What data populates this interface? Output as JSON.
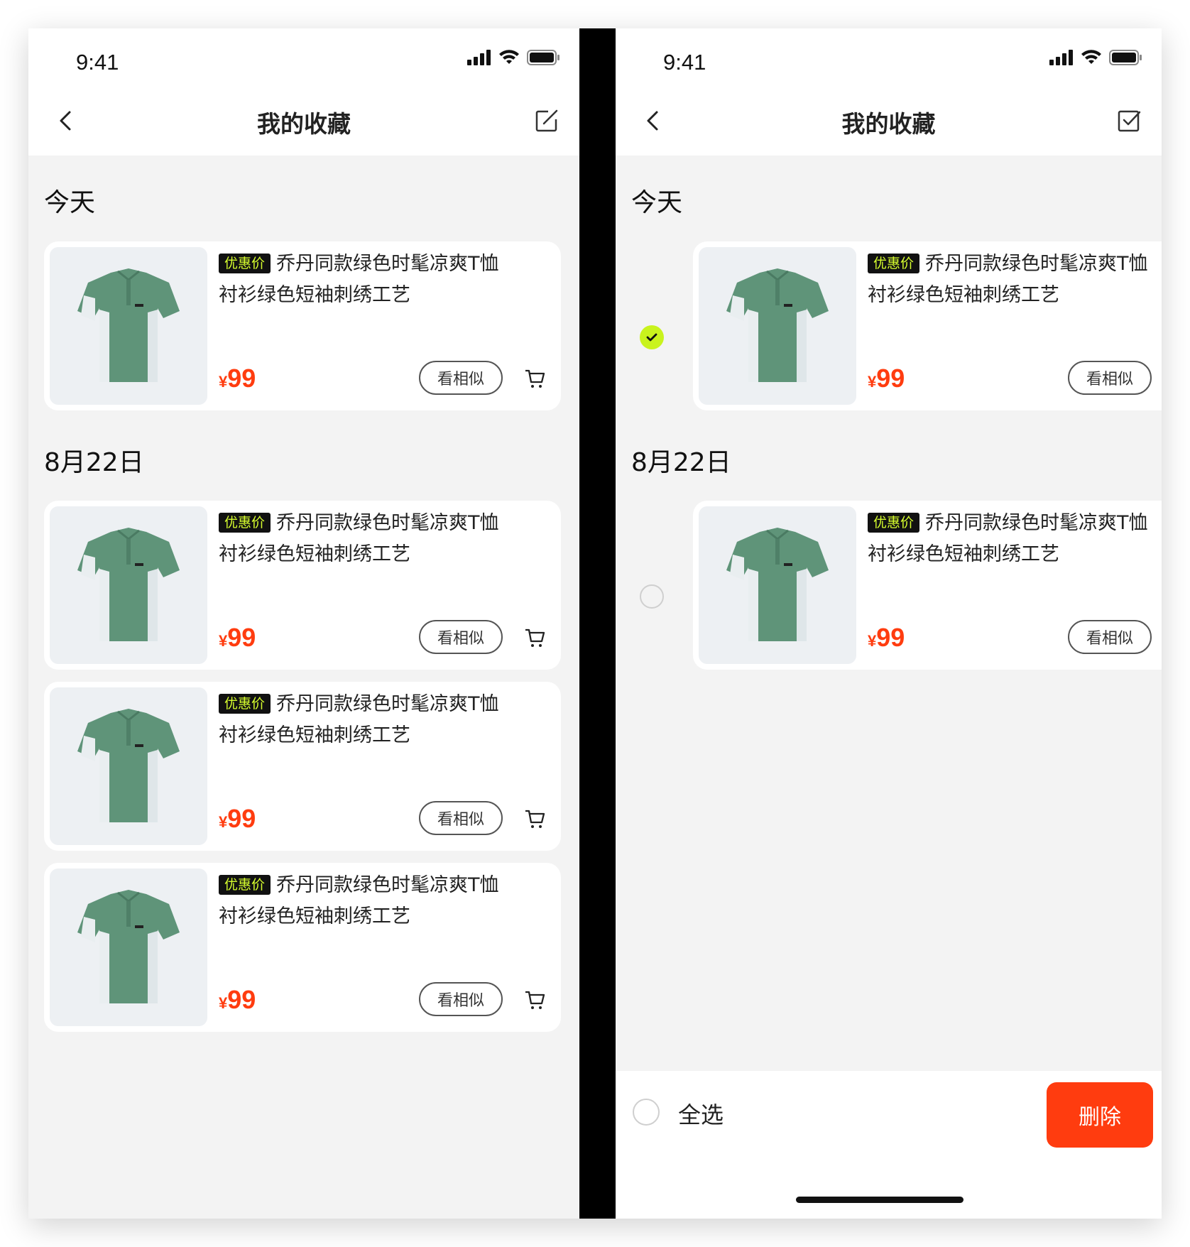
{
  "status": {
    "time": "9:41"
  },
  "nav": {
    "title": "我的收藏"
  },
  "left": {
    "sections": [
      {
        "label": "今天"
      },
      {
        "label": "8月22日"
      }
    ],
    "items": [
      {
        "badge": "优惠价",
        "name": "乔丹同款绿色时髦凉爽T恤衬衫绿色短袖刺绣工艺",
        "currency": "¥",
        "price": "99",
        "similar": "看相似"
      },
      {
        "badge": "优惠价",
        "name": "乔丹同款绿色时髦凉爽T恤衬衫绿色短袖刺绣工艺",
        "currency": "¥",
        "price": "99",
        "similar": "看相似"
      },
      {
        "badge": "优惠价",
        "name": "乔丹同款绿色时髦凉爽T恤衬衫绿色短袖刺绣工艺",
        "currency": "¥",
        "price": "99",
        "similar": "看相似"
      },
      {
        "badge": "优惠价",
        "name": "乔丹同款绿色时髦凉爽T恤衬衫绿色短袖刺绣工艺",
        "currency": "¥",
        "price": "99",
        "similar": "看相似"
      }
    ]
  },
  "right": {
    "sections": [
      {
        "label": "今天"
      },
      {
        "label": "8月22日"
      }
    ],
    "items": [
      {
        "selected": true,
        "badge": "优惠价",
        "name": "乔丹同款绿色时髦凉爽T恤衬衫绿色短袖刺绣工艺",
        "currency": "¥",
        "price": "99",
        "similar": "看相似"
      },
      {
        "selected": false,
        "badge": "优惠价",
        "name": "乔丹同款绿色时髦凉爽T恤衬衫绿色短袖刺绣工艺",
        "currency": "¥",
        "price": "99",
        "similar": "看相似"
      }
    ],
    "bottom": {
      "select_all": "全选",
      "delete": "删除"
    }
  },
  "icons": {
    "back": "chevron-left-icon",
    "edit": "edit-icon",
    "done": "check-square-icon",
    "cart": "cart-icon",
    "check": "check-icon"
  },
  "colors": {
    "accent": "#ff3c0f",
    "badge_bg": "#111111",
    "badge_text": "#d7ff2e",
    "check_on": "#c9f31d",
    "shirt": "#5f9479"
  }
}
